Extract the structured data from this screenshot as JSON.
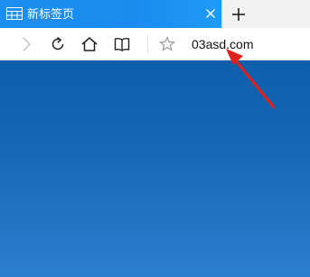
{
  "tab": {
    "title": "新标签页",
    "icon": "tab-page-icon",
    "close_icon": "close-icon"
  },
  "tabstrip": {
    "new_tab_icon": "plus-icon"
  },
  "toolbar": {
    "forward_icon": "chevron-right-icon",
    "refresh_icon": "refresh-icon",
    "home_icon": "home-icon",
    "reading_icon": "book-icon",
    "favorite_icon": "star-icon",
    "address_value": "03asd.com"
  },
  "annotation": {
    "arrow_color": "#e0201c"
  },
  "colors": {
    "tab_active": "#1b8ef1",
    "content_top": "#0d5fac",
    "content_bottom": "#2b7fce"
  }
}
